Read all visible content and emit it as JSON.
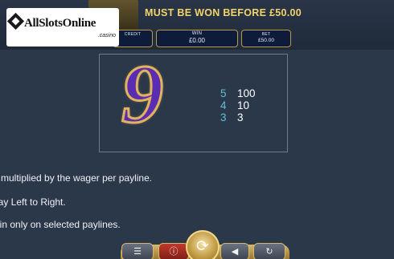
{
  "top_bar": {
    "jackpot_message": "MUST BE WON BEFORE £50.00",
    "credit": {
      "label": "CREDIT",
      "value": ""
    },
    "win": {
      "label": "WIN",
      "value": "£0.00"
    },
    "bet": {
      "label": "BET",
      "value": "£50.00"
    }
  },
  "watermark": {
    "brand": "AllSlotsOnline",
    "suffix": ".casino"
  },
  "paytable": {
    "symbol": "9",
    "payouts": [
      {
        "count": "5",
        "amount": "100"
      },
      {
        "count": "4",
        "amount": "10"
      },
      {
        "count": "3",
        "amount": "3"
      }
    ]
  },
  "rules": [
    "e multiplied by the wager per payline.",
    "pay Left to Right.",
    "win only on selected paylines."
  ],
  "controls": {
    "menu_icon": "menu-icon",
    "info_icon": "info-icon",
    "spin_icon": "spin-icon",
    "back_icon": "back-icon",
    "autoplay_icon": "autoplay-icon"
  },
  "colors": {
    "background": "#2b3849",
    "jackpot_text": "#f2d46a",
    "payout_count": "#5ec3d3",
    "symbol_purple": "#5a2bb3",
    "gold_trim": "#d8b868"
  }
}
